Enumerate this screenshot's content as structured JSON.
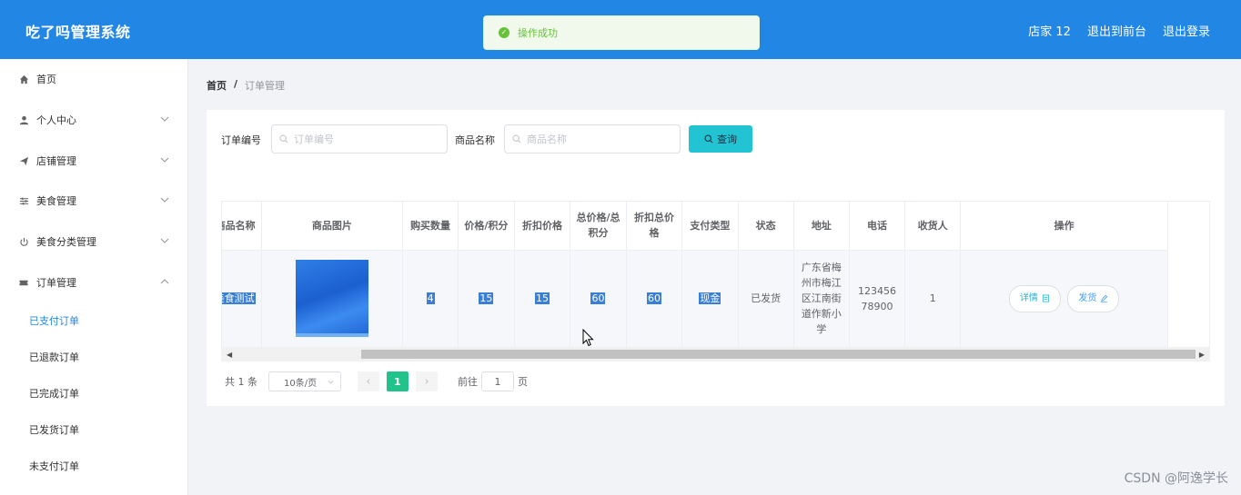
{
  "header": {
    "title": "吃了吗管理系统",
    "nav": {
      "user": "店家 12",
      "to_front": "退出到前台",
      "logout": "退出登录"
    }
  },
  "toast": {
    "message": "操作成功"
  },
  "sidebar": {
    "items": [
      {
        "label": "首页",
        "icon": "home-icon"
      },
      {
        "label": "个人中心",
        "icon": "user-icon"
      },
      {
        "label": "店铺管理",
        "icon": "send-icon"
      },
      {
        "label": "美食管理",
        "icon": "sliders-icon"
      },
      {
        "label": "美食分类管理",
        "icon": "power-icon"
      },
      {
        "label": "订单管理",
        "icon": "ticket-icon"
      }
    ],
    "sub_items": [
      "已支付订单",
      "已退款订单",
      "已完成订单",
      "已发货订单",
      "未支付订单"
    ]
  },
  "breadcrumb": {
    "home": "首页",
    "separator": "/",
    "current": "订单管理"
  },
  "search": {
    "order_no_label": "订单编号",
    "order_no_placeholder": "订单编号",
    "product_label": "商品名称",
    "product_placeholder": "商品名称",
    "query_button": "查询"
  },
  "table": {
    "headers": [
      "商品名称",
      "商品图片",
      "购买数量",
      "价格/积分",
      "折扣价格",
      "总价格/总积分",
      "折扣总价格",
      "支付类型",
      "状态",
      "地址",
      "电话",
      "收货人",
      "操作"
    ],
    "rows": [
      {
        "name": "美食测试",
        "quantity": "4",
        "price": "15",
        "discount_price": "15",
        "total": "60",
        "discount_total": "60",
        "pay_type": "现金",
        "status": "已发货",
        "address": "广东省梅州市梅江区江南街道作新小学",
        "phone": "12345678900",
        "receiver": "1",
        "detail_button": "详情",
        "ship_button": "发货"
      }
    ]
  },
  "pagination": {
    "total": "共 1 条",
    "page_size": "10条/页",
    "current_page": "1",
    "goto_prefix": "前往",
    "goto_value": "1",
    "goto_suffix": "页"
  },
  "watermark": "CSDN @阿逸学长",
  "colors": {
    "header": "#2287e4",
    "query_button": "#22c4d4",
    "page_active": "#22c38a",
    "toast_text": "#67c23a"
  }
}
